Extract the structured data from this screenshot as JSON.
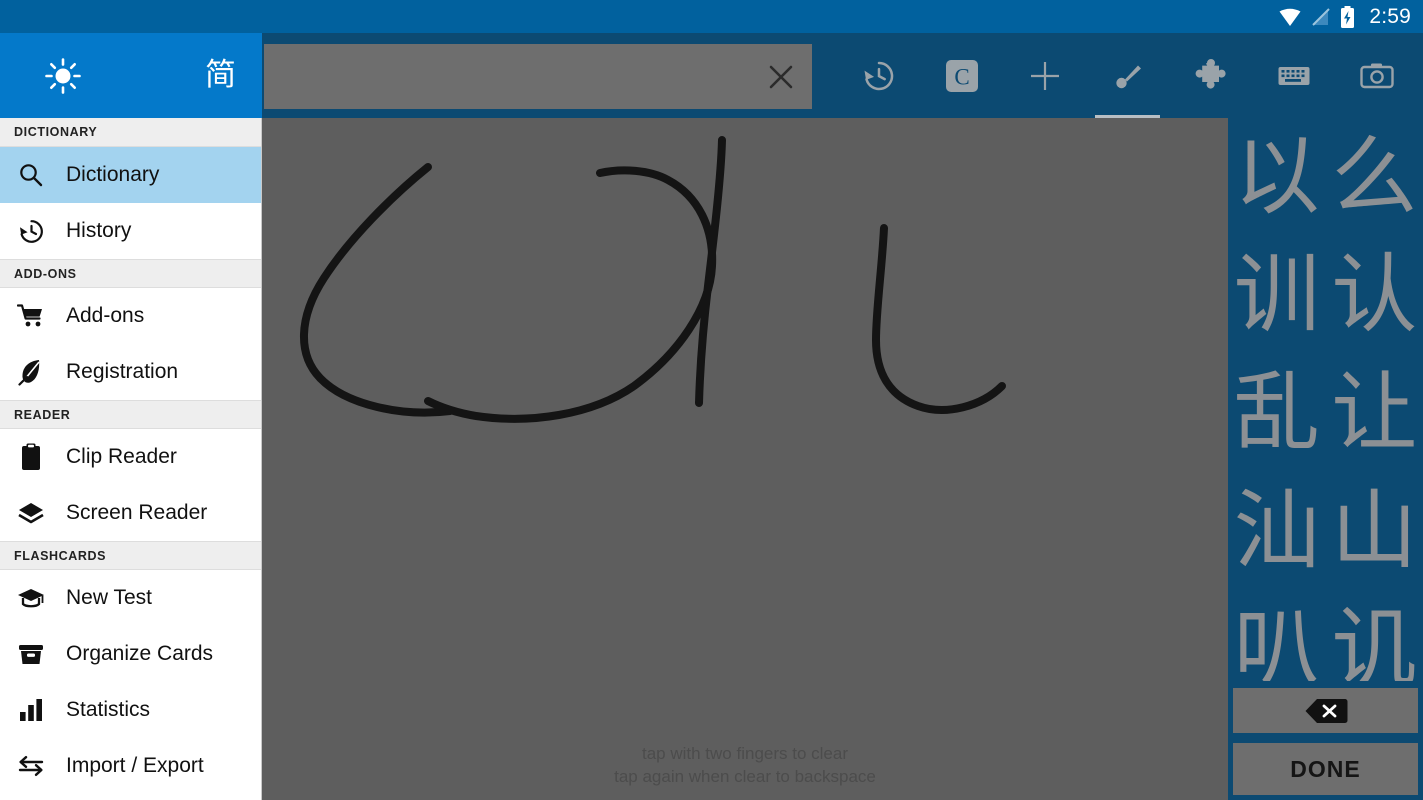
{
  "statusbar": {
    "time": "2:59",
    "icons": [
      "wifi-icon",
      "signal-off-icon",
      "battery-charging-icon"
    ]
  },
  "drawer_header": {
    "brightness_icon": "sun-icon",
    "language_toggle": "简"
  },
  "sidebar": {
    "sections": [
      {
        "title": "DICTIONARY",
        "items": [
          {
            "label": "Dictionary",
            "icon": "search-icon",
            "active": true
          },
          {
            "label": "History",
            "icon": "history-icon",
            "active": false
          }
        ]
      },
      {
        "title": "ADD-ONS",
        "items": [
          {
            "label": "Add-ons",
            "icon": "cart-icon",
            "active": false
          },
          {
            "label": "Registration",
            "icon": "feather-icon",
            "active": false
          }
        ]
      },
      {
        "title": "READER",
        "items": [
          {
            "label": "Clip Reader",
            "icon": "clipboard-icon",
            "active": false
          },
          {
            "label": "Screen Reader",
            "icon": "layers-icon",
            "active": false
          }
        ]
      },
      {
        "title": "FLASHCARDS",
        "items": [
          {
            "label": "New Test",
            "icon": "graduation-cap-icon",
            "active": false
          },
          {
            "label": "Organize Cards",
            "icon": "card-box-icon",
            "active": false
          },
          {
            "label": "Statistics",
            "icon": "bar-chart-icon",
            "active": false
          },
          {
            "label": "Import / Export",
            "icon": "transfer-arrows-icon",
            "active": false
          }
        ]
      }
    ]
  },
  "appbar": {
    "search": {
      "value": "",
      "placeholder": ""
    },
    "clear_icon": "close-icon",
    "tabs": [
      {
        "name": "history",
        "icon": "history-icon",
        "active": false
      },
      {
        "name": "clipboard-c",
        "icon": "letter-c-icon",
        "active": false
      },
      {
        "name": "add",
        "icon": "plus-icon",
        "active": false
      },
      {
        "name": "handwriting",
        "icon": "brush-icon",
        "active": true
      },
      {
        "name": "radicals",
        "icon": "puzzle-icon",
        "active": false
      },
      {
        "name": "keyboard",
        "icon": "keyboard-icon",
        "active": false
      },
      {
        "name": "camera",
        "icon": "camera-icon",
        "active": false
      }
    ]
  },
  "canvas": {
    "hint_line1": "tap with two fingers to clear",
    "hint_line2": "tap again when clear to backspace",
    "strokes": 4
  },
  "candidates": {
    "rows": [
      [
        "以",
        "么"
      ],
      [
        "训",
        "认"
      ],
      [
        "乱",
        "让"
      ],
      [
        "汕",
        "山"
      ],
      [
        "叭",
        "讥"
      ]
    ],
    "backspace_icon": "backspace-icon",
    "done_label": "DONE"
  },
  "colors": {
    "status_blue": "#01619e",
    "drawer_blue": "#0479ca",
    "appbar_blue": "#0c4a72",
    "canvas_gray": "#5e5e5e",
    "selected_row": "#a3d3ef",
    "button_gray": "#6e6e6e"
  }
}
